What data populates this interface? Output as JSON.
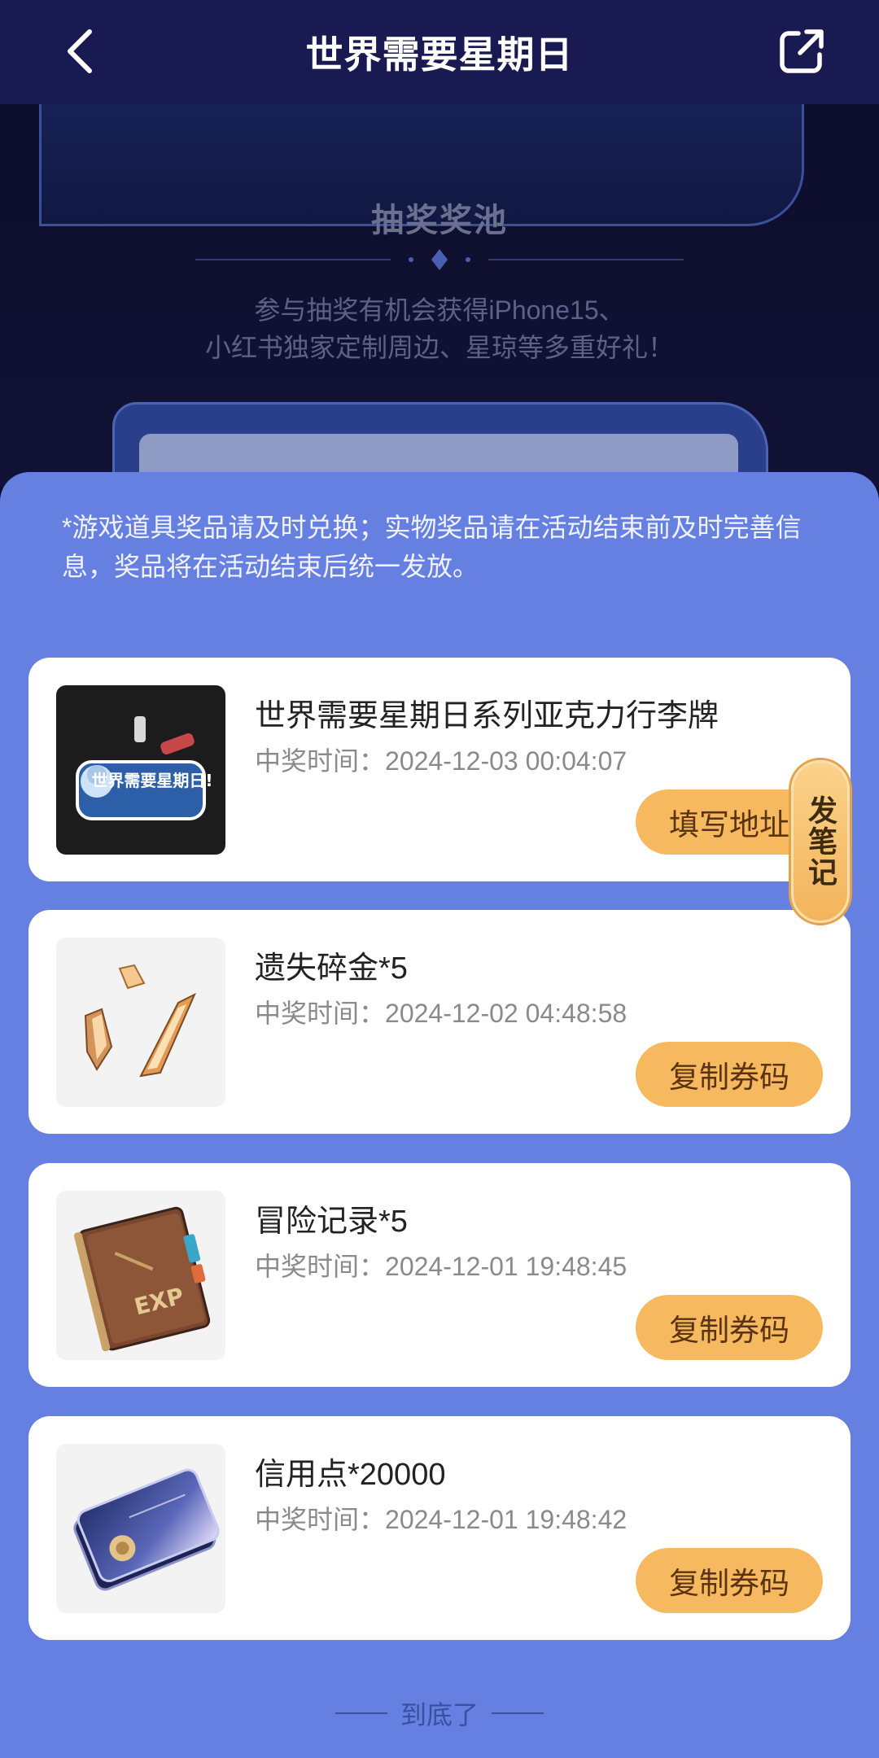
{
  "header": {
    "title": "世界需要星期日",
    "back_icon": "chevron-left-icon",
    "share_icon": "share-icon"
  },
  "pool": {
    "title": "抽奖奖池",
    "desc_line1": "参与抽奖有机会获得iPhone15、",
    "desc_line2": "小红书独家定制周边、星琼等多重好礼！"
  },
  "notice": "*游戏道具奖品请及时兑换；实物奖品请在活动结束前及时完善信息，奖品将在活动结束后统一发放。",
  "prizes": [
    {
      "name": "世界需要星期日系列亚克力行李牌",
      "time_label": "中奖时间：",
      "time": "2024-12-03 00:04:07",
      "button": "填写地址",
      "thumb_text": "世界需要星期日!"
    },
    {
      "name": "遗失碎金*5",
      "time_label": "中奖时间：",
      "time": "2024-12-02 04:48:58",
      "button": "复制券码"
    },
    {
      "name": "冒险记录*5",
      "time_label": "中奖时间：",
      "time": "2024-12-01 19:48:45",
      "button": "复制券码",
      "thumb_text": "EXP"
    },
    {
      "name": "信用点*20000",
      "time_label": "中奖时间：",
      "time": "2024-12-01 19:48:42",
      "button": "复制券码"
    }
  ],
  "side_tab": "发笔记",
  "bottom_text": "到底了",
  "colors": {
    "header_bg": "#1a1a52",
    "panel_bg": "#6580e0",
    "button_bg": "#f7b960",
    "card_bg": "#ffffff"
  }
}
